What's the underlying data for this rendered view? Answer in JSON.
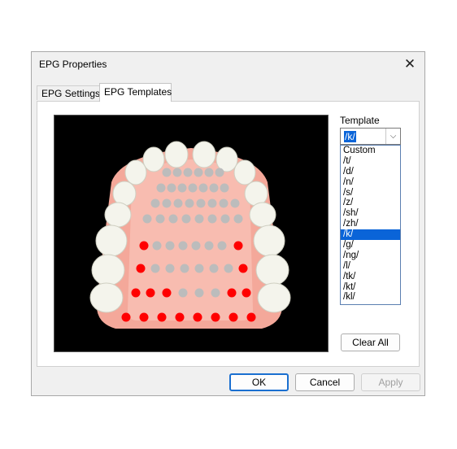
{
  "window": {
    "title": "EPG Properties",
    "close_glyph": "✕"
  },
  "tabs": [
    {
      "label": "EPG Settings",
      "active": false
    },
    {
      "label": "EPG Templates",
      "active": true
    }
  ],
  "template": {
    "label": "Template",
    "selected": "/k/",
    "arrow_glyph": "⌵",
    "options": [
      "Custom",
      "/t/",
      "/d/",
      "/n/",
      "/s/",
      "/z/",
      "/sh/",
      "/zh/",
      "/k/",
      "/g/",
      "/ng/",
      "/l/",
      "/tk/",
      "/kt/",
      "/kl/"
    ]
  },
  "buttons": {
    "clear_all": "Clear All",
    "ok": "OK",
    "cancel": "Cancel",
    "apply": "Apply"
  },
  "colors": {
    "active_electrode": "#ff0000",
    "inactive_electrode": "#bcbcbc",
    "palate": "#f6b2a6",
    "teeth": "#f2f2ea",
    "background": "#000000"
  }
}
